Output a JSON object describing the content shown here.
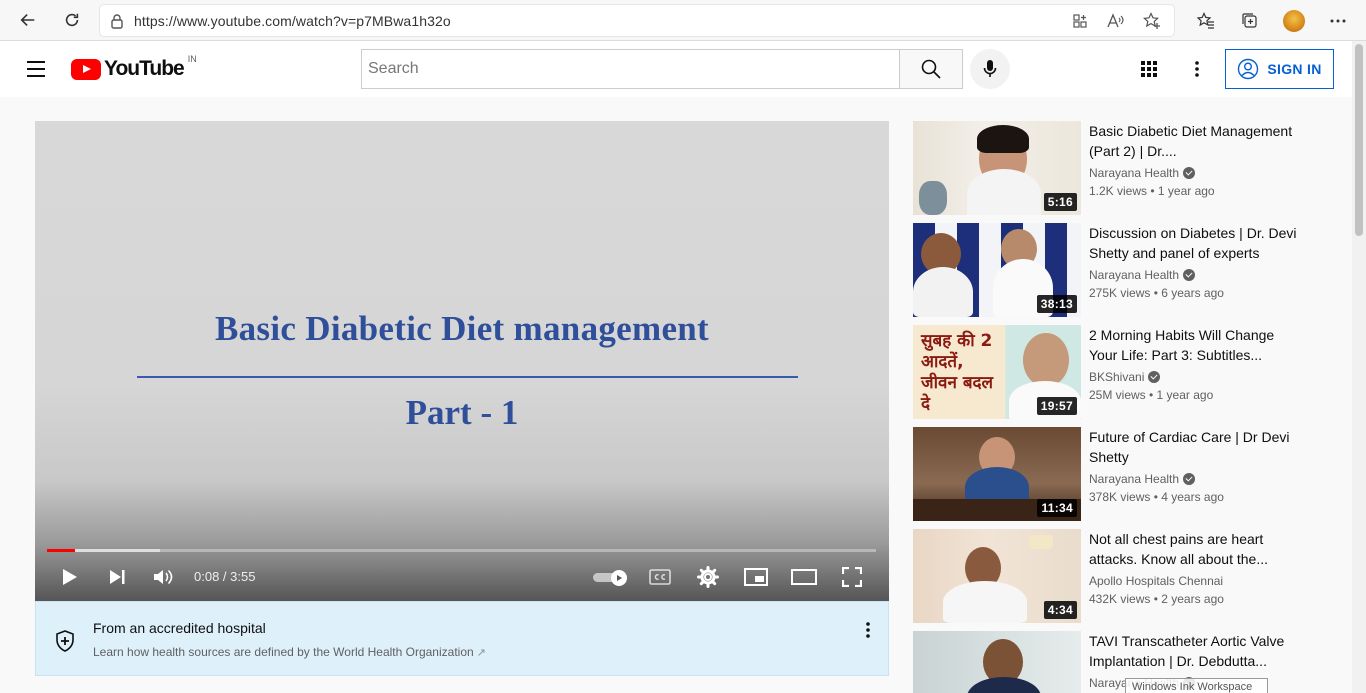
{
  "browser": {
    "url": "https://www.youtube.com/watch?v=p7MBwa1h32o"
  },
  "masthead": {
    "logo_text": "YouTube",
    "country_code": "IN",
    "search_placeholder": "Search",
    "signin_label": "SIGN IN"
  },
  "player": {
    "slide_title": "Basic Diabetic Diet management",
    "slide_subtitle": "Part - 1",
    "time_display": "0:08 / 3:55",
    "progress_fraction": 0.034,
    "buffered_fraction": 0.136
  },
  "health_panel": {
    "title": "From an accredited hospital",
    "subtitle": "Learn how health sources are defined by the World Health Organization"
  },
  "recommendations": [
    {
      "title": "Basic Diabetic Diet Management (Part 2) | Dr....",
      "channel": "Narayana Health",
      "meta": "1.2K views • 1 year ago",
      "duration": "5:16",
      "verified": true
    },
    {
      "title": "Discussion on Diabetes | Dr. Devi Shetty and panel of experts",
      "channel": "Narayana Health",
      "meta": "275K views • 6 years ago",
      "duration": "38:13",
      "verified": true
    },
    {
      "title": "2 Morning Habits Will Change Your Life: Part 3: Subtitles...",
      "channel": "BKShivani",
      "meta": "25M views • 1 year ago",
      "duration": "19:57",
      "verified": true,
      "thumb_text": "सुबह की 2 आदतें, जीवन बदल दे"
    },
    {
      "title": "Future of Cardiac Care | Dr Devi Shetty",
      "channel": "Narayana Health",
      "meta": "378K views • 4 years ago",
      "duration": "11:34",
      "verified": true
    },
    {
      "title": "Not all chest pains are heart attacks. Know all about the...",
      "channel": "Apollo Hospitals Chennai",
      "meta": "432K views • 2 years ago",
      "duration": "4:34",
      "verified": false
    },
    {
      "title": "TAVI Transcatheter Aortic Valve Implantation | Dr. Debdutta...",
      "channel": "Narayana Health",
      "meta": "",
      "duration": "",
      "verified": true
    }
  ],
  "overlay": {
    "watermark": "Windows Ink Workspace"
  }
}
